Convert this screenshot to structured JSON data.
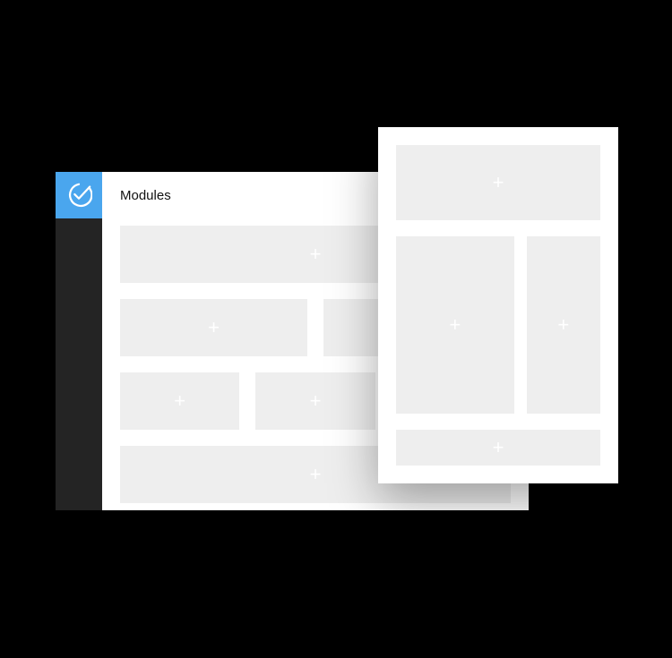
{
  "brand": {
    "accent": "#4aa6ee",
    "sidebar_bg": "#242424",
    "tile_bg": "#eeeeee",
    "plus_glyph": "✕"
  },
  "header": {
    "title": "Modules"
  },
  "grid": {
    "row1": [
      {
        "add_label": "+"
      }
    ],
    "row2": [
      {
        "add_label": "+"
      },
      {
        "add_label": "+"
      }
    ],
    "row3": [
      {
        "add_label": "+"
      },
      {
        "add_label": "+"
      },
      {
        "add_label": "+"
      }
    ],
    "row4": [
      {
        "add_label": "+"
      }
    ]
  },
  "floating": {
    "row1": [
      {
        "add_label": "+"
      }
    ],
    "row2": [
      {
        "add_label": "+"
      },
      {
        "add_label": "+"
      }
    ],
    "row3": [
      {
        "add_label": "+"
      }
    ]
  }
}
